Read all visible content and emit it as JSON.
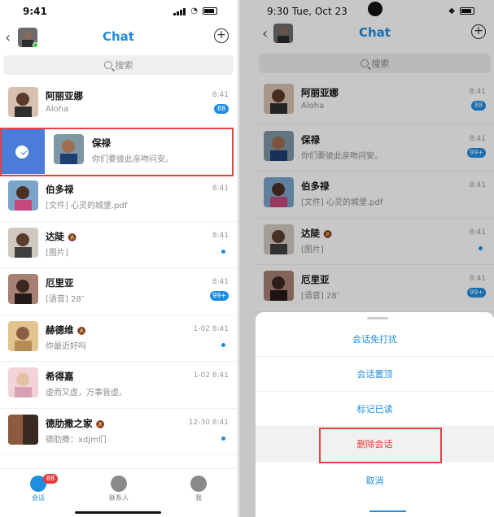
{
  "left": {
    "status_time": "9:41",
    "title": "Chat",
    "search_placeholder": "搜索",
    "conversations": [
      {
        "name": "阿丽亚娜",
        "preview": "Aloha",
        "time": "8:41",
        "badge": "88"
      },
      {
        "name": "保禄",
        "preview": "你们要彼此亲吻问安。",
        "time": "",
        "badge": ""
      },
      {
        "name": "伯多禄",
        "preview": "[文件] 心灵的城堡.pdf",
        "time": "8:41",
        "badge": ""
      },
      {
        "name": "达陡",
        "preview": "[图片]",
        "time": "8:41",
        "badge": ""
      },
      {
        "name": "厄里亚",
        "preview": "[语音] 28″",
        "time": "8:41",
        "badge": "99+"
      },
      {
        "name": "赫德维",
        "preview": "你最近好吗",
        "time": "1-02 8:41",
        "badge": ""
      },
      {
        "name": "希得嘉",
        "preview": "虚而又虚，万事皆虚。",
        "time": "1-02 8:41",
        "badge": ""
      },
      {
        "name": "德肋撒之家",
        "preview": "德肋撒：xdjm们",
        "time": "12-30 8:41",
        "badge": ""
      }
    ],
    "tabbar": {
      "chats_label": "会话",
      "chats_badge": "88",
      "contacts_label": "联系人",
      "me_label": "我"
    }
  },
  "right": {
    "status_time": "9:30",
    "status_date": "Tue, Oct 23",
    "title": "Chat",
    "search_placeholder": "搜索",
    "conversations": [
      {
        "name": "阿丽亚娜",
        "preview": "Aloha",
        "time": "8:41",
        "badge": "88"
      },
      {
        "name": "保禄",
        "preview": "你们要彼此亲吻问安。",
        "time": "8:41",
        "badge": "99+"
      },
      {
        "name": "伯多禄",
        "preview": "[文件] 心灵的城堡.pdf",
        "time": "8:41",
        "badge": ""
      },
      {
        "name": "达陡",
        "preview": "[图片]",
        "time": "8:41",
        "badge": ""
      },
      {
        "name": "厄里亚",
        "preview": "[语音] 28″",
        "time": "8:41",
        "badge": "99+"
      }
    ],
    "sheet": {
      "option_1": "会话免打扰",
      "option_2": "会话置顶",
      "option_3": "标记已读",
      "option_4": "删除会话",
      "cancel": "取消"
    }
  },
  "colors": {
    "accent": "#1f8de0",
    "danger": "#e53b3b",
    "swipe_bg": "#4a7dd8"
  }
}
